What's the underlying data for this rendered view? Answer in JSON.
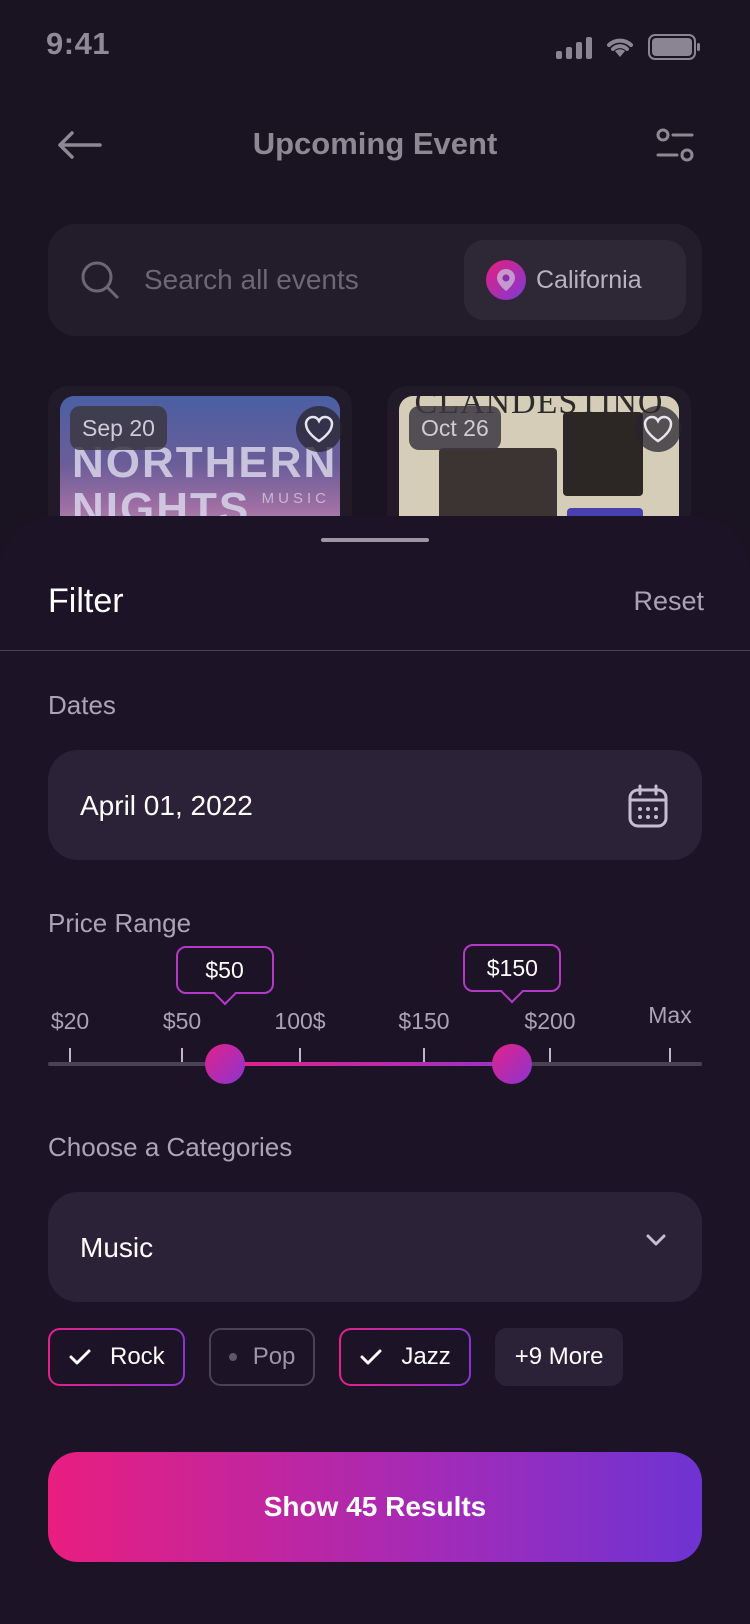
{
  "status_bar": {
    "time": "9:41",
    "signal_icon": "cellular-signal-icon",
    "wifi_icon": "wifi-icon",
    "battery_icon": "battery-icon"
  },
  "header": {
    "title": "Upcoming Event",
    "back_icon": "arrow-left-icon",
    "settings_icon": "sliders-icon"
  },
  "search": {
    "placeholder": "Search all events",
    "location": "California"
  },
  "events": [
    {
      "date": "Sep 20",
      "poster_title_1": "NORTHERN",
      "poster_title_2": "NIGHTS",
      "poster_sub": "MUSIC"
    },
    {
      "date": "Oct 26",
      "poster_title_1": "CLANDESTINO"
    }
  ],
  "filter": {
    "title": "Filter",
    "reset": "Reset",
    "dates": {
      "label": "Dates",
      "value": "April 01, 2022"
    },
    "price": {
      "label": "Price Range",
      "ticks": [
        "$20",
        "$50",
        "100$",
        "$150",
        "$200",
        "Max"
      ],
      "low_label": "$50",
      "high_label": "$150",
      "low_fraction": 0.27,
      "high_fraction": 0.71
    },
    "categories": {
      "label": "Choose a Categories",
      "selected": "Music",
      "chips": [
        {
          "label": "Rock",
          "selected": true
        },
        {
          "label": "Pop",
          "selected": false
        },
        {
          "label": "Jazz",
          "selected": true
        },
        {
          "label": "+9 More",
          "selected": false
        }
      ]
    },
    "cta": "Show 45 Results"
  },
  "colors": {
    "accent_start": "#e91e7f",
    "accent_end": "#6e33d3",
    "sheet_bg": "#1c1327"
  }
}
